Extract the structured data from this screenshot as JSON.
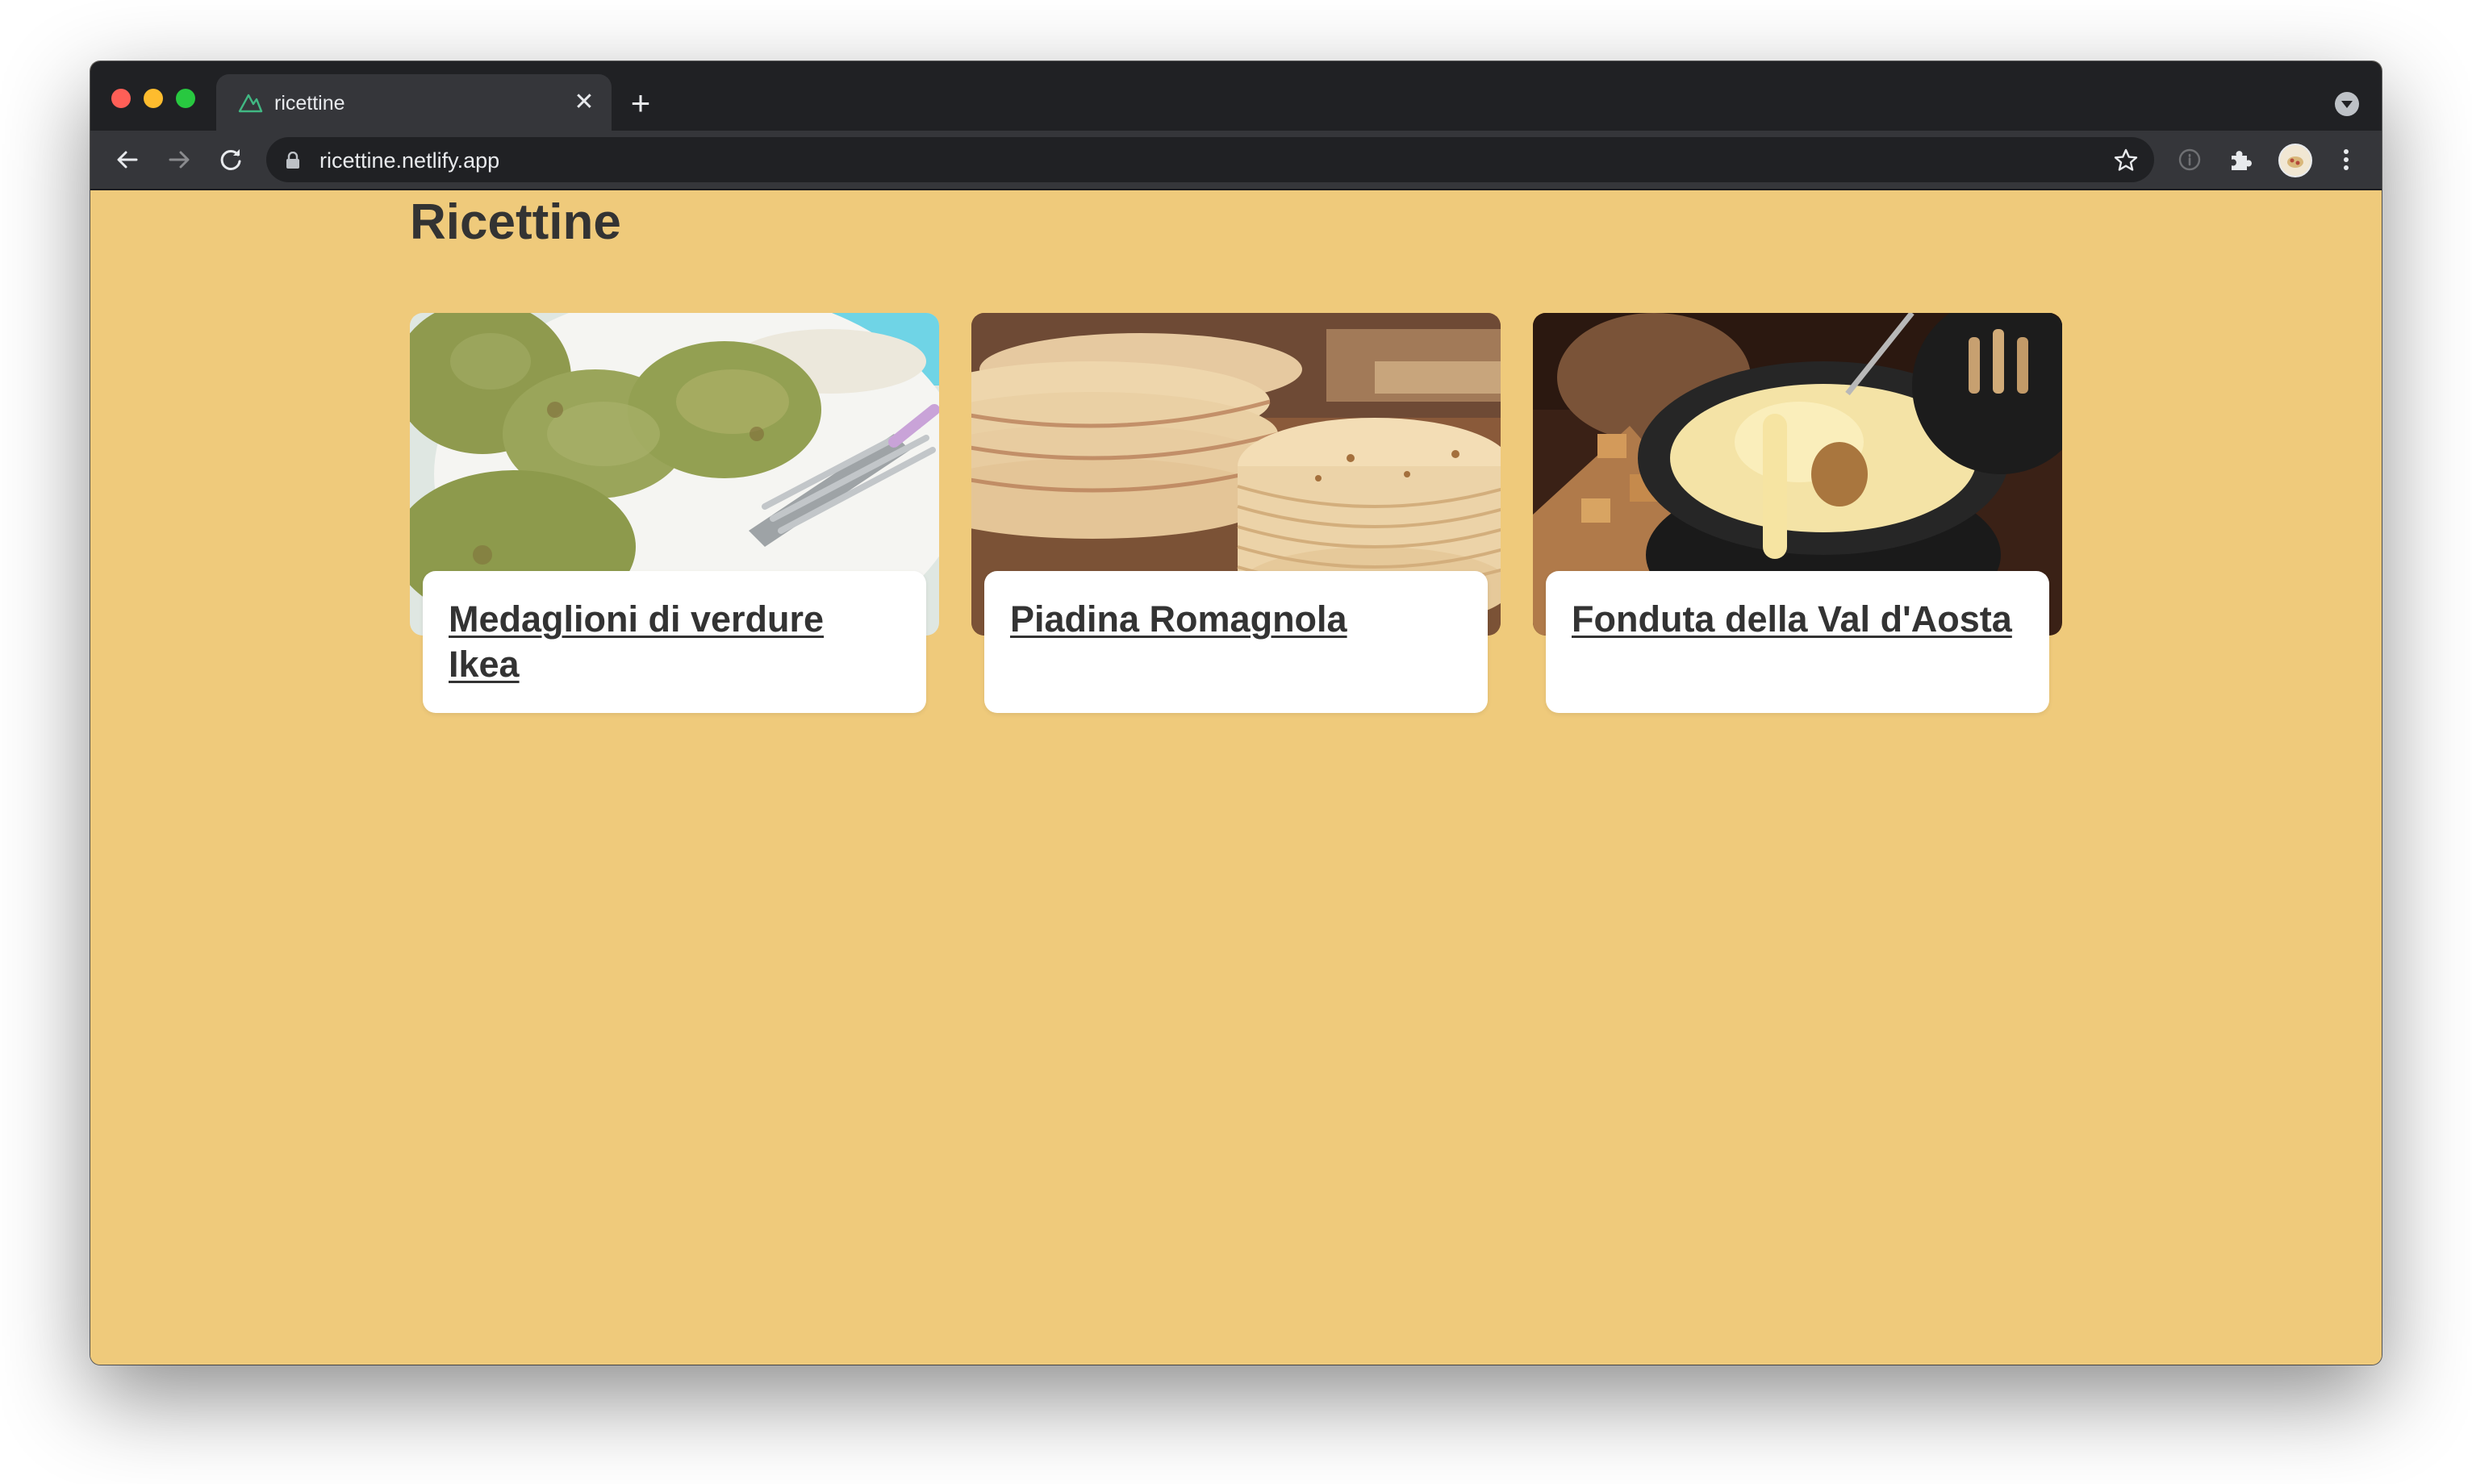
{
  "browser": {
    "tab_title": "ricettine",
    "tab_close": "✕",
    "new_tab": "+",
    "url": "ricettine.netlify.app",
    "icons": [
      "back-icon",
      "forward-icon",
      "reload-icon",
      "lock-icon",
      "star-icon",
      "info-icon",
      "extensions-icon",
      "profile-avatar",
      "menu-icon"
    ]
  },
  "page": {
    "title": "Ricettine",
    "background": "#efca7b",
    "recipes": [
      {
        "title": "Medaglioni di verdure Ikea",
        "image": "vegetable-patties-photo"
      },
      {
        "title": "Piadina Romagnola",
        "image": "piadina-stack-photo"
      },
      {
        "title": "Fonduta della Val d'Aosta",
        "image": "fondue-pot-photo"
      }
    ]
  }
}
